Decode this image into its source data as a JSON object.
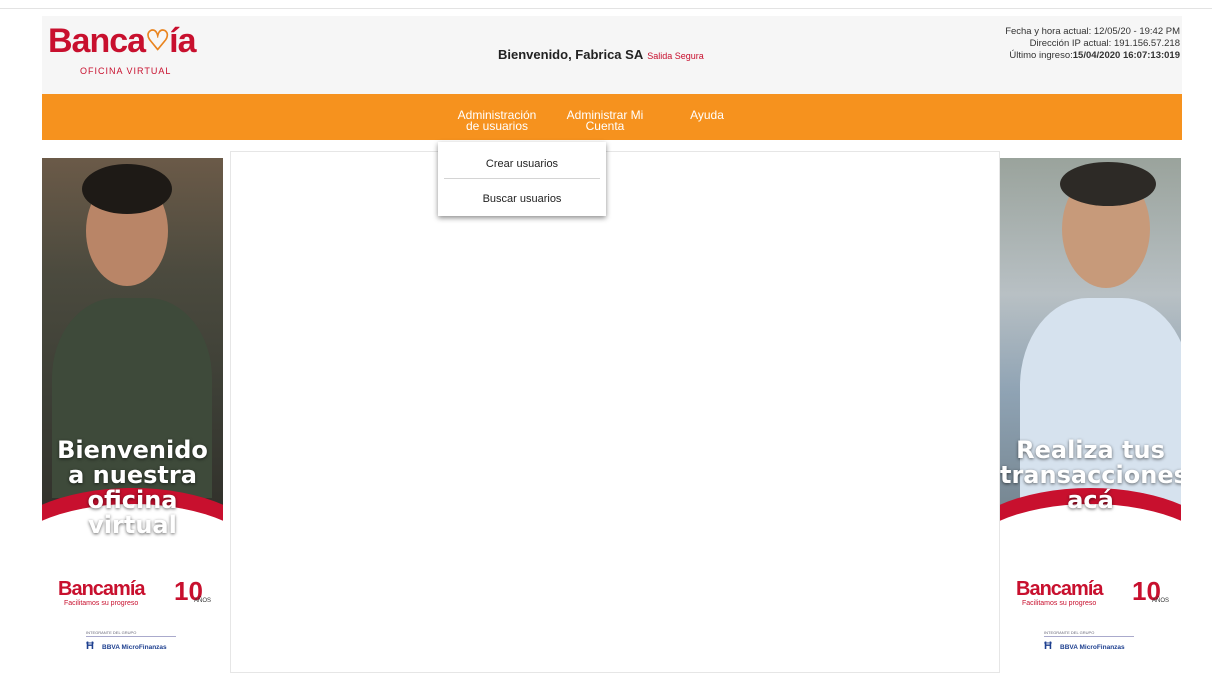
{
  "header": {
    "logo_text": "Banca",
    "logo_text_end": "ía",
    "logo_subtitle": "OFICINA VIRTUAL",
    "welcome": "Bienvenido, Fabrica SA",
    "safe_exit": "Salida Segura",
    "info_line1": "Fecha y hora actual: 12/05/20 - 19:42 PM",
    "info_line2": "Dirección IP actual: 191.156.57.218",
    "info_line3_label": "Último ingreso:",
    "info_line3_value": "15/04/2020 16:07:13:019"
  },
  "nav": {
    "admin_line1": "Administración",
    "admin_line2": "de usuarios",
    "cuenta_line1": "Administrar Mi",
    "cuenta_line2": "Cuenta",
    "ayuda": "Ayuda"
  },
  "dropdown": {
    "items": [
      "Crear usuarios",
      "Buscar usuarios"
    ]
  },
  "banner_left": {
    "line1": "Bienvenido",
    "line2": "a nuestra",
    "line3": "oficina virtual"
  },
  "banner_right": {
    "line1": "Realiza tus",
    "line2": "transacciones",
    "line3": "acá"
  },
  "brand": {
    "word": "Bancamía",
    "tagline": "Facilitamos su progreso",
    "ten": "10",
    "anos": "AÑOS",
    "fund_small": "INTEGRANTE DEL GRUPO",
    "fund_name": "BBVA MicroFinanzas"
  },
  "colors": {
    "brand_red": "#c8102e",
    "nav_orange": "#f6921e"
  }
}
